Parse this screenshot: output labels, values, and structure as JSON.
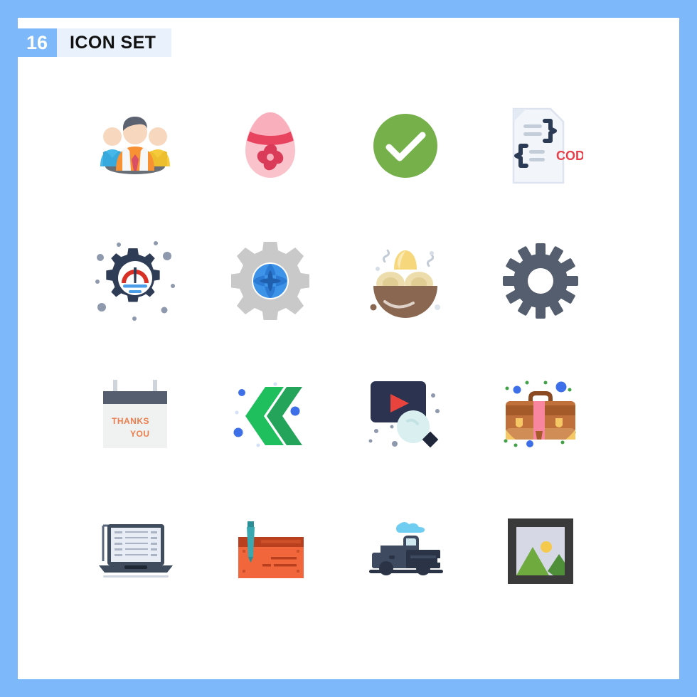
{
  "page": {
    "frame_color": "#7db8fb",
    "background": "#ffffff"
  },
  "header": {
    "count": "16",
    "title": "ICON SET",
    "badge_color": "#7db8fb",
    "title_background": "#e9f2fc",
    "title_color": "#111111"
  },
  "grid": {
    "columns": 4,
    "rows": 4,
    "total": 16,
    "icons": [
      {
        "index": 1,
        "name": "team-group-icon",
        "label": "Team",
        "colors": [
          "#f79134",
          "#f2c230",
          "#38b6e6",
          "#f7d2b8",
          "#65696f"
        ]
      },
      {
        "index": 2,
        "name": "easter-egg-icon",
        "label": "Easter Egg",
        "colors": [
          "#f9c2ca",
          "#e8435f",
          "#d63b58"
        ]
      },
      {
        "index": 3,
        "name": "check-circle-icon",
        "label": "Approved",
        "colors": [
          "#76b04b",
          "#ffffff"
        ]
      },
      {
        "index": 4,
        "name": "code-file-icon",
        "label": "Code",
        "colors": [
          "#e8edf5",
          "#2b3a55",
          "#e8404a"
        ],
        "text": "CODE"
      },
      {
        "index": 5,
        "name": "gear-gauge-icon",
        "label": "Performance",
        "colors": [
          "#2f3c56",
          "#ffffff",
          "#d93025",
          "#4a9ee8"
        ]
      },
      {
        "index": 6,
        "name": "gear-globe-icon",
        "label": "Global Settings",
        "colors": [
          "#c9c9c9",
          "#3d93e8",
          "#1f5fae"
        ]
      },
      {
        "index": 7,
        "name": "food-bowl-icon",
        "label": "Food Bowl",
        "colors": [
          "#8a6750",
          "#f2d98a",
          "#f5c84e"
        ]
      },
      {
        "index": 8,
        "name": "gear-settings-icon",
        "label": "Settings",
        "colors": [
          "#555e6e"
        ]
      },
      {
        "index": 9,
        "name": "thank-you-sign-icon",
        "label": "Thank You",
        "colors": [
          "#555e6e",
          "#f0f1f1",
          "#ec7f4e"
        ],
        "text": [
          "THANKS",
          "YOU"
        ]
      },
      {
        "index": 10,
        "name": "double-chevron-left-icon",
        "label": "Rewind",
        "colors": [
          "#1fbf5e",
          "#23a45a",
          "#3d6fe8"
        ]
      },
      {
        "index": 11,
        "name": "video-search-icon",
        "label": "Video Search",
        "colors": [
          "#2b3350",
          "#e8433d",
          "#d9eff0"
        ]
      },
      {
        "index": 12,
        "name": "briefcase-icon",
        "label": "Briefcase",
        "colors": [
          "#a55a2a",
          "#c06a33",
          "#f7869e",
          "#f5c765",
          "#3d6fe8",
          "#3fa346"
        ]
      },
      {
        "index": 13,
        "name": "laptop-document-icon",
        "label": "Laptop",
        "colors": [
          "#3e4c5e",
          "#e8ecf4",
          "#aab4c4"
        ]
      },
      {
        "index": 14,
        "name": "cheque-pen-icon",
        "label": "Cheque",
        "colors": [
          "#f2663c",
          "#b8401f",
          "#3aa8b0"
        ]
      },
      {
        "index": 15,
        "name": "pickup-truck-icon",
        "label": "Delivery Truck",
        "colors": [
          "#3d4a60",
          "#2b3447",
          "#6fcdf2"
        ]
      },
      {
        "index": 16,
        "name": "image-frame-icon",
        "label": "Picture",
        "colors": [
          "#3a3a3a",
          "#d6d9e5",
          "#6faa3f",
          "#4f8f3a",
          "#f5c84e"
        ]
      }
    ]
  }
}
